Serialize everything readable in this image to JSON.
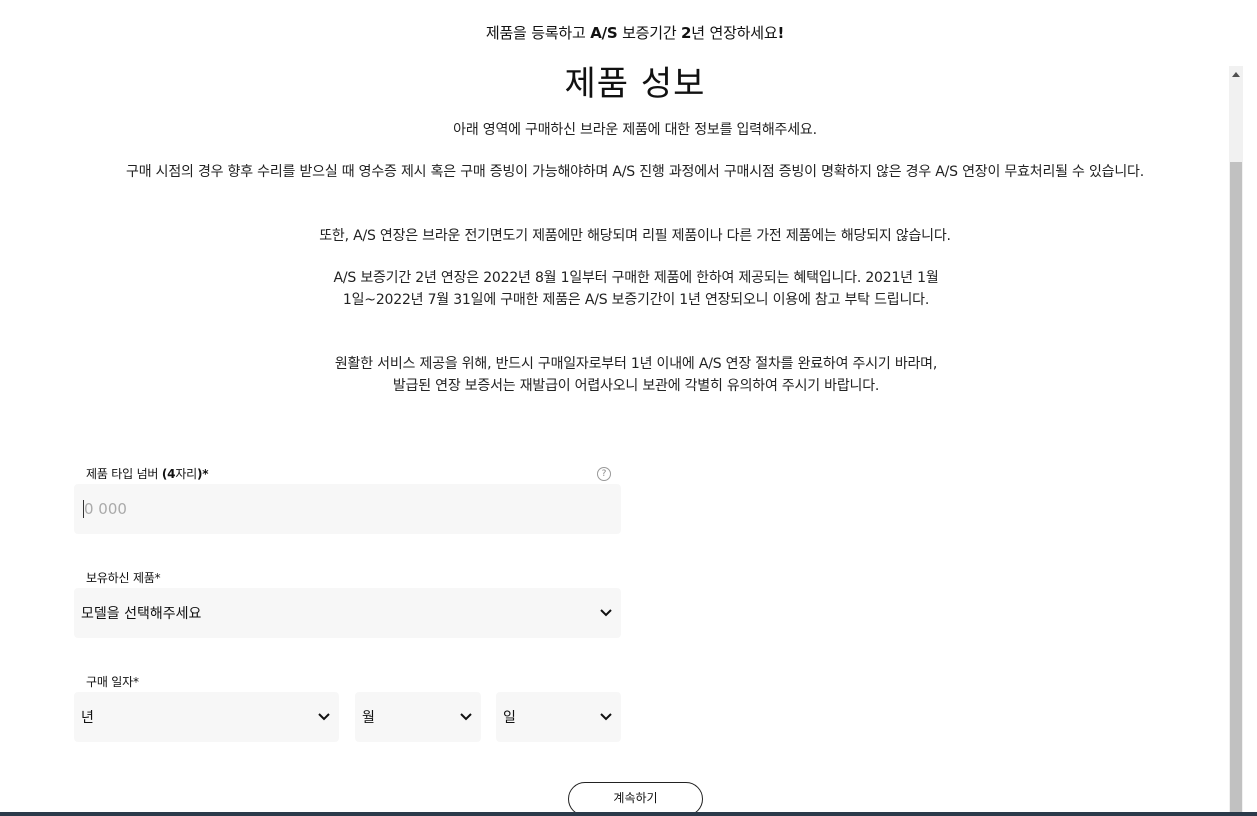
{
  "banner": {
    "part1": "제품을 등록하고 ",
    "bold1": "A/S",
    "part2": " 보증기간 ",
    "bold2": "2",
    "part3": "년 연장하세요",
    "bold3": "!"
  },
  "title": "제품 성보",
  "info": {
    "p1": "아래 영역에 구매하신 브라운 제품에 대한 정보를 입력해주세요.",
    "p2": "구매 시점의 경우 향후 수리를 받으실 때 영수증 제시 혹은 구매 증빙이 가능해야하며 A/S 진행 과정에서 구매시점 증빙이 명확하지 않은 경우 A/S 연장이 무효처리될 수 있습니다.",
    "p3": "또한, A/S 연장은 브라운 전기면도기 제품에만 해당되며 리필 제품이나 다른 가전 제품에는 해당되지 않습니다.",
    "p4": "A/S 보증기간 2년 연장은 2022년 8월 1일부터 구매한 제품에 한하여 제공되는 혜택입니다. 2021년 1월 1일~2022년 7월 31일에 구매한 제품은 A/S 보증기간이 1년 연장되오니 이용에 참고 부탁 드립니다.",
    "p5": "원활한 서비스 제공을 위해, 반드시 구매일자로부터 1년 이내에 A/S 연장 절차를 완료하여 주시기 바라며, 발급된 연장 보증서는 재발급이 어렵사오니 보관에 각별히 유의하여 주시기 바랍니다."
  },
  "form": {
    "type_number": {
      "label_part1": "제품 타입 넘버 ",
      "label_bold": "(4",
      "label_part2": "자리",
      "label_bold2": ")*",
      "placeholder": "0 000",
      "value": "",
      "help_glyph": "?"
    },
    "product": {
      "label": "보유하신 제품*",
      "selected": "모델을 선택해주세요"
    },
    "purchase_date": {
      "label": "구매 일자*",
      "year": "년",
      "month": "월",
      "day": "일"
    }
  },
  "continue_label": "계속하기",
  "colors": {
    "field_bg": "#f7f7f7",
    "scroll_thumb": "#c1c1c1",
    "bottom_rule": "#2b3a4a"
  }
}
